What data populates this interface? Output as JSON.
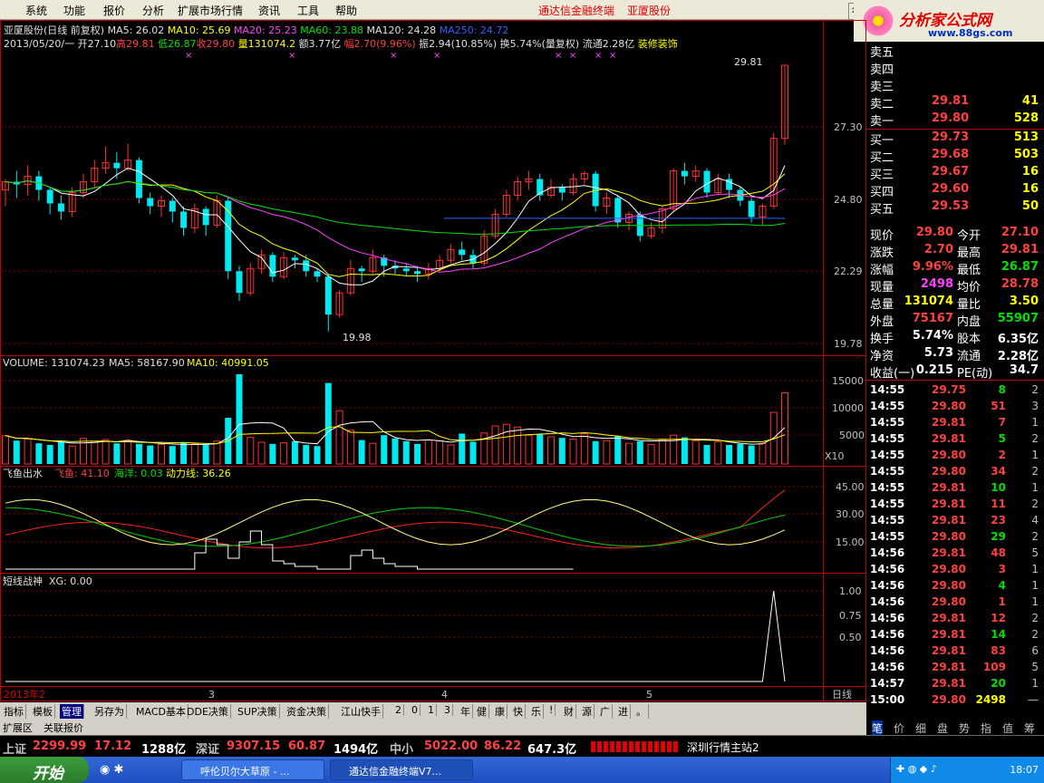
{
  "menu": {
    "items": [
      "系统",
      "功能",
      "报价",
      "分析",
      "扩展市场行情",
      "资讯",
      "工具",
      "帮助"
    ],
    "title1": "通达信金融终端",
    "title2": "亚厦股份",
    "right_btn": "行"
  },
  "brand": {
    "logo": "分析家公式网",
    "url": "www.88gs.com"
  },
  "info": {
    "line1": {
      "name": "亚厦股份(日线 前复权)",
      "ma5": "MA5: 26.02",
      "ma10": "MA10: 25.69",
      "ma20": "MA20: 25.23",
      "ma60": "MA60: 23.88",
      "ma120": "MA120: 24.28",
      "ma250": "MA250: 24.72"
    },
    "line2": {
      "date": "2013/05/20/一",
      "open": "开27.10",
      "high": "高29.81",
      "low": "低26.87",
      "close": "收29.80",
      "vol": "量131074.2",
      "amt": "额3.77亿",
      "chg": "幅2.70(9.96%)",
      "amp": "振2.94(10.85%)",
      "turn": "换5.74%(量复权)",
      "float": "流通2.28亿",
      "industry": "装修装饰"
    }
  },
  "price_axis": [
    "27.30",
    "24.80",
    "22.29",
    "19.78"
  ],
  "price_marks": {
    "high": "29.81",
    "low": "19.98"
  },
  "volume": {
    "label": "VOLUME: 131074.23",
    "ma5": "MA5: 58167.90",
    "ma10": "MA10: 40991.05",
    "axis": [
      "15000",
      "10000",
      "5000"
    ],
    "unit": "X10"
  },
  "ind1": {
    "name": "飞鱼出水",
    "a": "飞鱼: 41.10",
    "b": "海洋: 0.03",
    "c": "动力线: 36.26",
    "axis": [
      "45.00",
      "30.00",
      "15.00"
    ]
  },
  "ind2": {
    "name": "短线战神",
    "a": "XG: 0.00",
    "axis": [
      "1.00",
      "0.75",
      "0.50"
    ]
  },
  "date_axis": {
    "year": "2013年2",
    "m3": "3",
    "m4": "4",
    "m5": "5",
    "period": "日线"
  },
  "orderbook": [
    {
      "l": "卖五",
      "p": "",
      "v": ""
    },
    {
      "l": "卖四",
      "p": "",
      "v": ""
    },
    {
      "l": "卖三",
      "p": "",
      "v": ""
    },
    {
      "l": "卖二",
      "p": "29.81",
      "v": "41"
    },
    {
      "l": "卖一",
      "p": "29.80",
      "v": "528"
    },
    {
      "l": "买一",
      "p": "29.73",
      "v": "513"
    },
    {
      "l": "买二",
      "p": "29.68",
      "v": "503"
    },
    {
      "l": "买三",
      "p": "29.67",
      "v": "16"
    },
    {
      "l": "买四",
      "p": "29.60",
      "v": "16"
    },
    {
      "l": "买五",
      "p": "29.53",
      "v": "50"
    }
  ],
  "quote": [
    {
      "a": "现价",
      "av": "29.80",
      "b": "今开",
      "bv": "27.10"
    },
    {
      "a": "涨跌",
      "av": "2.70",
      "b": "最高",
      "bv": "29.81"
    },
    {
      "a": "涨幅",
      "av": "9.96%",
      "b": "最低",
      "bv": "26.87"
    },
    {
      "a": "现量",
      "av": "2498",
      "b": "均价",
      "bv": "28.78"
    },
    {
      "a": "总量",
      "av": "131074",
      "b": "量比",
      "bv": "3.50"
    },
    {
      "a": "外盘",
      "av": "75167",
      "b": "内盘",
      "bv": "55907"
    },
    {
      "a": "换手",
      "av": "5.74%",
      "b": "股本",
      "bv": "6.35亿"
    },
    {
      "a": "净资",
      "av": "5.73",
      "b": "流通",
      "bv": "2.28亿"
    },
    {
      "a": "收益(一)",
      "av": "0.215",
      "b": "PE(动)",
      "bv": "34.7"
    }
  ],
  "ticks": [
    [
      "14:55",
      "29.75",
      "8",
      "2"
    ],
    [
      "14:55",
      "29.80",
      "51",
      "3"
    ],
    [
      "14:55",
      "29.81",
      "7",
      "1"
    ],
    [
      "14:55",
      "29.81",
      "5",
      "2"
    ],
    [
      "14:55",
      "29.80",
      "2",
      "1"
    ],
    [
      "14:55",
      "29.80",
      "34",
      "2"
    ],
    [
      "14:55",
      "29.81",
      "10",
      "1"
    ],
    [
      "14:55",
      "29.81",
      "11",
      "2"
    ],
    [
      "14:55",
      "29.81",
      "23",
      "4"
    ],
    [
      "14:55",
      "29.80",
      "29",
      "2"
    ],
    [
      "14:56",
      "29.81",
      "48",
      "5"
    ],
    [
      "14:56",
      "29.80",
      "3",
      "1"
    ],
    [
      "14:56",
      "29.80",
      "4",
      "1"
    ],
    [
      "14:56",
      "29.80",
      "1",
      "1"
    ],
    [
      "14:56",
      "29.81",
      "12",
      "2"
    ],
    [
      "14:56",
      "29.81",
      "14",
      "2"
    ],
    [
      "14:56",
      "29.81",
      "83",
      "6"
    ],
    [
      "14:56",
      "29.81",
      "109",
      "5"
    ],
    [
      "14:57",
      "29.81",
      "20",
      "1"
    ],
    [
      "15:00",
      "29.80",
      "2498",
      "—"
    ]
  ],
  "rtabs": [
    "笔",
    "价",
    "细",
    "盘",
    "势",
    "指",
    "值",
    "筹"
  ],
  "btabs": [
    "指标",
    "模板",
    "管理",
    "另存为",
    "MACD基本",
    "DDE决策",
    "SUP决策",
    "资金决策",
    "江山快手",
    "2",
    "0",
    "1",
    "3",
    "年",
    "健",
    "康",
    "快",
    "乐",
    "!",
    "财",
    "源",
    "广",
    "进",
    "。"
  ],
  "btabs2": [
    "扩展区",
    "关联报价"
  ],
  "status": {
    "sh_l": "上证",
    "sh_v": "2299.99",
    "sh_c": "17.12",
    "sh_a": "1288亿",
    "sz_l": "深证",
    "sz_v": "9307.15",
    "sz_c": "60.87",
    "sz_a": "1494亿",
    "zx_l": "中小",
    "zx_v": "5022.00",
    "zx_c": "86.22",
    "zx_a": "647.3亿",
    "server": "深圳行情主站2"
  },
  "taskbar": {
    "start": "开始",
    "t1": "呼伦贝尔大草原 - ...",
    "t2": "通达信金融终端V7...",
    "time": "18:07"
  },
  "chart_data": {
    "type": "candlestick",
    "candles": [
      [
        25.2,
        25.5,
        24.6,
        25.6
      ],
      [
        25.5,
        25.4,
        24.9,
        25.9
      ],
      [
        25.4,
        25.7,
        25.0,
        26.1
      ],
      [
        25.7,
        25.2,
        24.8,
        25.9
      ],
      [
        25.2,
        24.7,
        24.3,
        25.3
      ],
      [
        24.7,
        24.4,
        24.1,
        25.0
      ],
      [
        24.4,
        25.1,
        24.2,
        25.3
      ],
      [
        25.1,
        25.5,
        24.9,
        25.8
      ],
      [
        25.5,
        26.0,
        25.3,
        26.3
      ],
      [
        26.0,
        26.2,
        25.8,
        26.8
      ],
      [
        26.2,
        26.0,
        25.6,
        26.6
      ],
      [
        26.0,
        26.3,
        25.9,
        26.9
      ],
      [
        26.3,
        24.9,
        24.7,
        26.4
      ],
      [
        24.9,
        24.6,
        24.3,
        25.1
      ],
      [
        24.6,
        24.8,
        24.2,
        25.0
      ],
      [
        24.8,
        24.4,
        24.0,
        24.9
      ],
      [
        24.4,
        23.8,
        23.5,
        24.6
      ],
      [
        23.8,
        24.5,
        23.6,
        24.7
      ],
      [
        24.5,
        23.9,
        23.5,
        24.6
      ],
      [
        23.9,
        24.8,
        23.8,
        25.0
      ],
      [
        24.8,
        22.2,
        21.9,
        24.9
      ],
      [
        22.2,
        21.4,
        21.1,
        22.4
      ],
      [
        21.4,
        22.3,
        21.3,
        22.5
      ],
      [
        22.3,
        22.8,
        22.1,
        23.0
      ],
      [
        22.8,
        22.0,
        21.8,
        22.9
      ],
      [
        22.0,
        22.7,
        21.9,
        22.9
      ],
      [
        22.7,
        22.6,
        22.3,
        22.8
      ],
      [
        22.6,
        22.2,
        22.0,
        22.8
      ],
      [
        22.2,
        22.0,
        21.8,
        22.3
      ],
      [
        22.0,
        20.6,
        19.98,
        22.1
      ],
      [
        20.6,
        21.4,
        20.5,
        21.5
      ],
      [
        21.4,
        22.3,
        21.3,
        22.6
      ],
      [
        22.3,
        22.2,
        21.8,
        22.4
      ],
      [
        22.2,
        22.7,
        22.1,
        23.0
      ],
      [
        22.7,
        22.4,
        22.0,
        22.8
      ],
      [
        22.4,
        22.3,
        22.1,
        22.6
      ],
      [
        22.3,
        22.2,
        22.0,
        22.5
      ],
      [
        22.2,
        22.1,
        21.8,
        22.4
      ],
      [
        22.1,
        22.3,
        21.9,
        22.5
      ],
      [
        22.3,
        22.6,
        22.2,
        22.8
      ],
      [
        22.6,
        23.0,
        22.5,
        23.2
      ],
      [
        23.0,
        22.8,
        22.6,
        23.3
      ],
      [
        22.8,
        22.5,
        22.3,
        23.0
      ],
      [
        22.5,
        23.5,
        22.4,
        23.7
      ],
      [
        23.5,
        24.3,
        23.4,
        24.5
      ],
      [
        24.3,
        25.0,
        24.2,
        25.2
      ],
      [
        25.0,
        25.5,
        24.8,
        25.7
      ],
      [
        25.5,
        25.6,
        25.2,
        25.9
      ],
      [
        25.6,
        25.0,
        24.8,
        25.8
      ],
      [
        25.0,
        25.3,
        24.9,
        25.6
      ],
      [
        25.3,
        25.1,
        24.8,
        25.4
      ],
      [
        25.1,
        25.6,
        25.0,
        25.8
      ],
      [
        25.6,
        25.8,
        25.4,
        25.9
      ],
      [
        25.8,
        24.6,
        24.4,
        25.9
      ],
      [
        24.6,
        24.9,
        24.3,
        25.1
      ],
      [
        24.9,
        24.0,
        23.8,
        25.0
      ],
      [
        24.0,
        24.3,
        23.7,
        24.4
      ],
      [
        24.3,
        23.5,
        23.3,
        24.4
      ],
      [
        23.5,
        23.8,
        23.4,
        24.0
      ],
      [
        23.8,
        24.5,
        23.6,
        24.6
      ],
      [
        24.5,
        25.9,
        24.4,
        26.0
      ],
      [
        25.9,
        25.7,
        25.4,
        26.2
      ],
      [
        25.7,
        25.9,
        25.5,
        26.1
      ],
      [
        25.9,
        25.1,
        24.9,
        26.0
      ],
      [
        25.1,
        25.6,
        25.0,
        25.8
      ],
      [
        25.6,
        25.2,
        24.9,
        25.8
      ],
      [
        25.2,
        24.8,
        24.6,
        25.3
      ],
      [
        24.8,
        24.2,
        24.0,
        24.9
      ],
      [
        24.2,
        24.6,
        23.9,
        24.7
      ],
      [
        24.6,
        27.1,
        24.5,
        27.3
      ],
      [
        27.1,
        29.8,
        26.87,
        29.81
      ]
    ],
    "volume": [
      5200,
      4300,
      4600,
      3800,
      3500,
      4100,
      3300,
      4700,
      4200,
      4500,
      3800,
      4400,
      3700,
      3400,
      3600,
      3300,
      3900,
      3700,
      3500,
      4200,
      8500,
      16500,
      4900,
      4000,
      3700,
      3900,
      4200,
      3500,
      3300,
      14900,
      9800,
      6200,
      4400,
      3800,
      5300,
      4700,
      4200,
      3700,
      4400,
      4300,
      3500,
      5600,
      4100,
      5700,
      7000,
      7300,
      6800,
      5300,
      5500,
      5000,
      4800,
      4600,
      5600,
      4200,
      4300,
      5200,
      3800,
      4200,
      3600,
      4600,
      5300,
      4900,
      4300,
      3500,
      4100,
      3500,
      3700,
      3400,
      3800,
      9500,
      13100
    ],
    "ylim": [
      19.5,
      30.2
    ]
  }
}
